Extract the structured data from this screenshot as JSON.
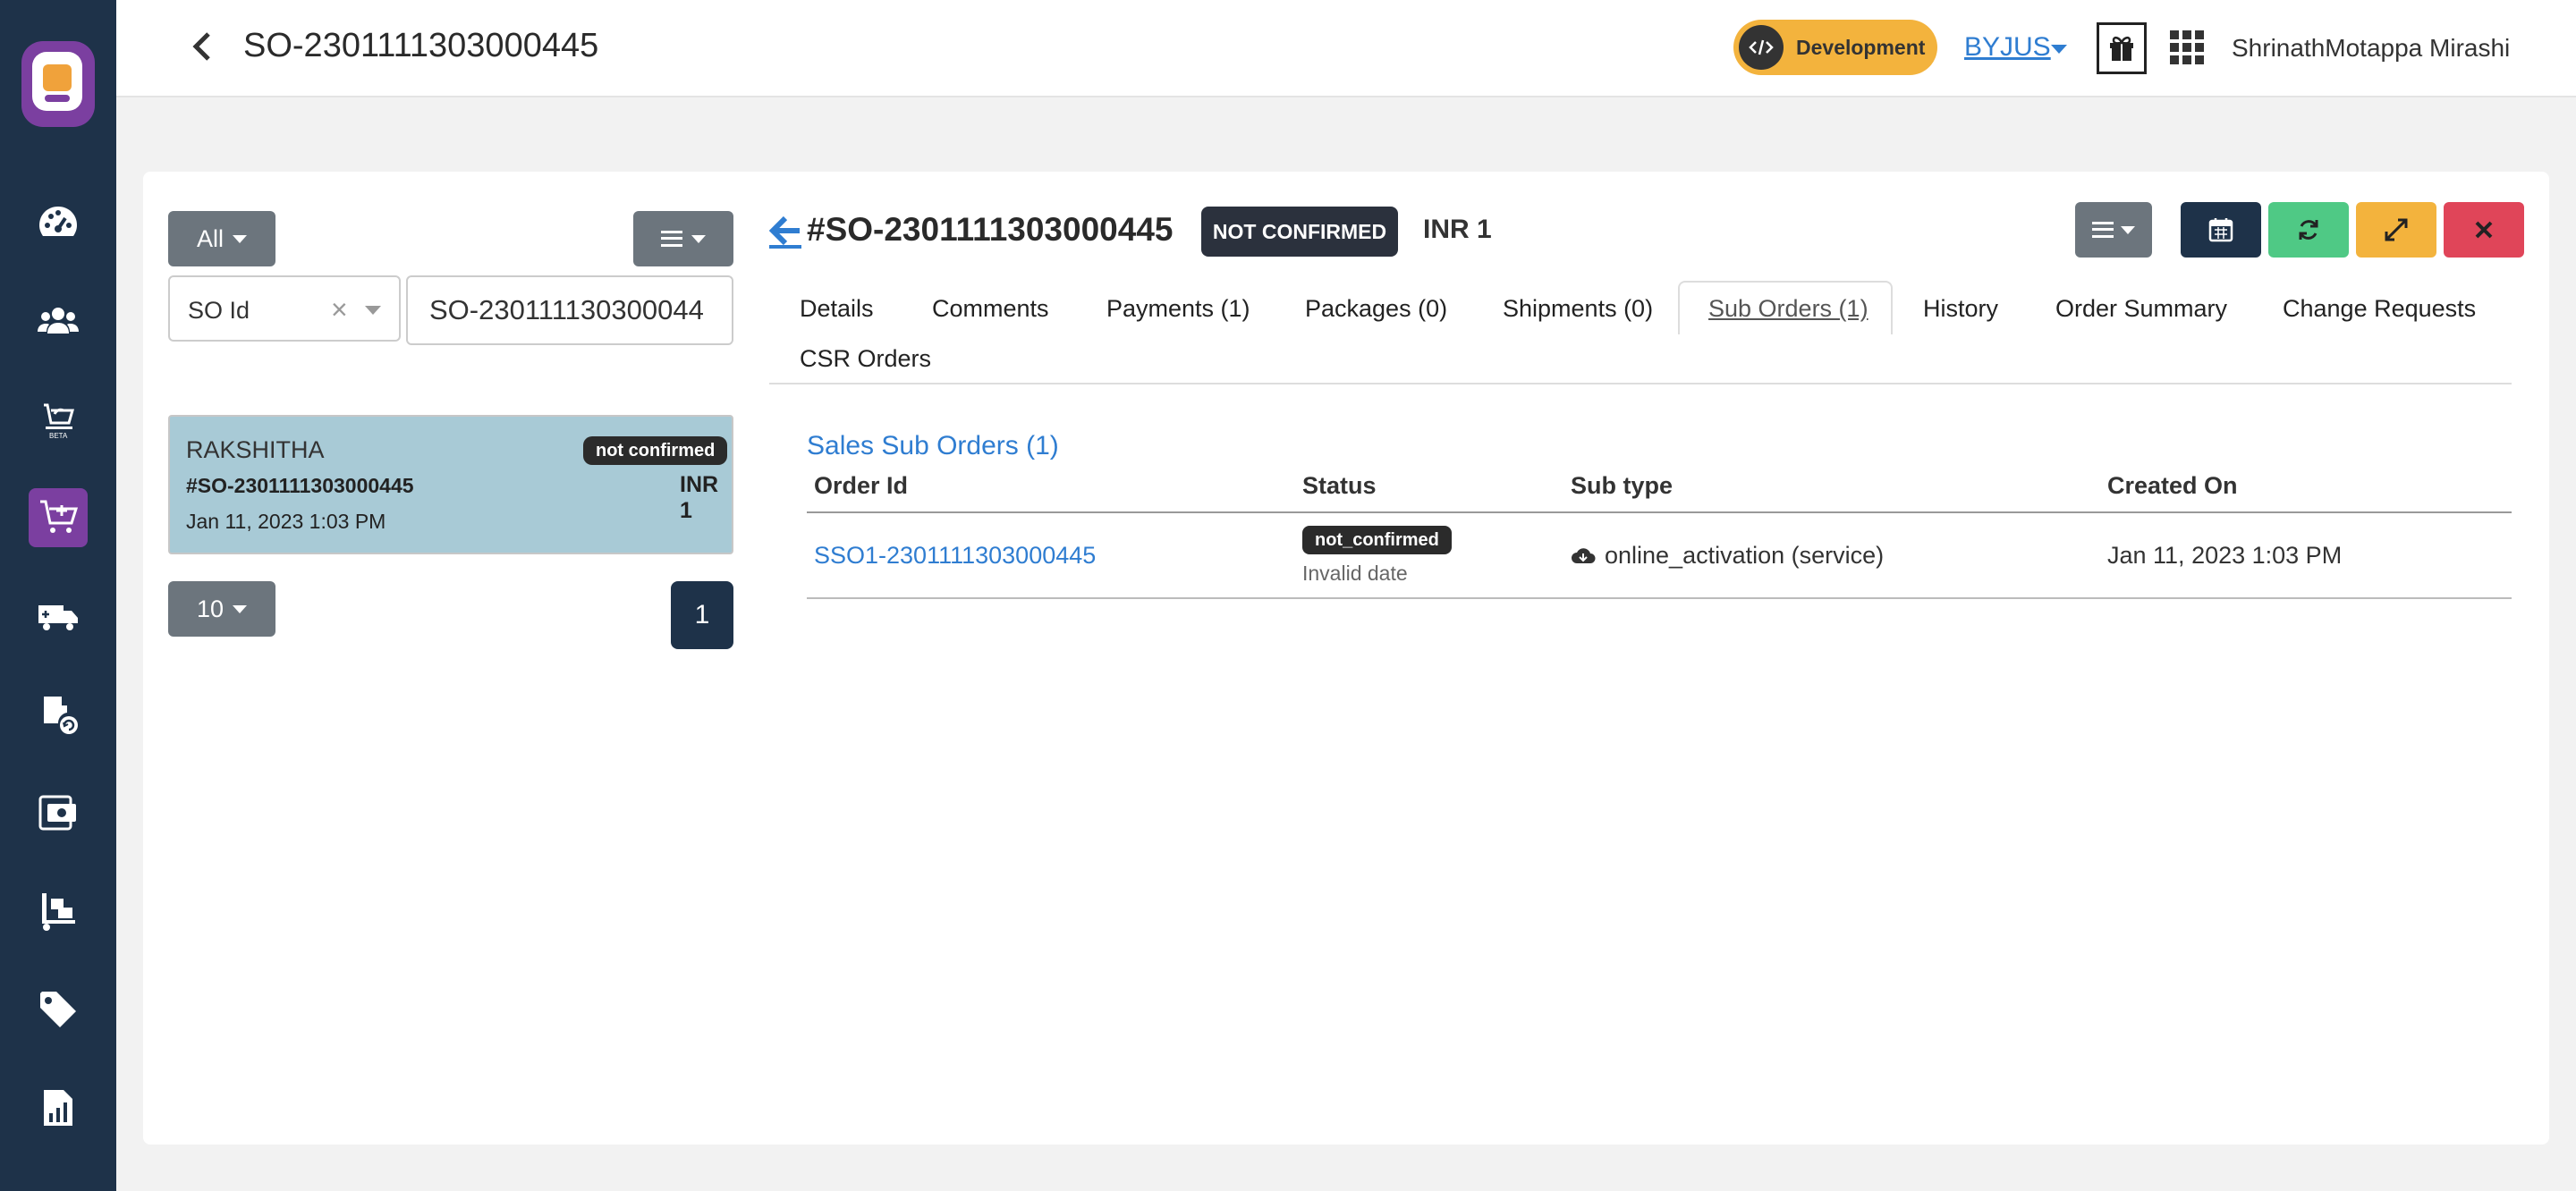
{
  "topbar": {
    "title": "SO-2301111303000445",
    "env_label": "Development",
    "org": "BYJUS",
    "user": "ShrinathMotappa Mirashi"
  },
  "sidebar": {
    "items": [
      {
        "icon": "dashboard-icon"
      },
      {
        "icon": "users-icon"
      },
      {
        "icon": "beta-catalog-icon"
      },
      {
        "icon": "cart-add-icon",
        "active": true
      },
      {
        "icon": "truck-icon"
      },
      {
        "icon": "returns-icon"
      },
      {
        "icon": "payments-icon"
      },
      {
        "icon": "warehouse-icon"
      },
      {
        "icon": "tag-icon"
      },
      {
        "icon": "reports-icon"
      }
    ]
  },
  "left_panel": {
    "filter_label": "All",
    "select_field": "SO Id",
    "search_value": "SO-230111130300044",
    "order": {
      "customer": "RAKSHITHA",
      "status": "not confirmed",
      "id": "#SO-2301111303000445",
      "amount": "INR 1",
      "date": "Jan 11, 2023 1:03 PM"
    },
    "page_size": "10",
    "current_page": "1"
  },
  "detail": {
    "order_id": "#SO-2301111303000445",
    "status": "NOT CONFIRMED",
    "total": "INR 1",
    "colors": {
      "dark": "#1e3249",
      "green": "#4fc985",
      "yellow": "#f3b33d",
      "red": "#e04559",
      "gray": "#6c757d"
    },
    "tabs": [
      "Details",
      "Comments",
      "Payments (1)",
      "Packages (0)",
      "Shipments (0)",
      "Sub Orders (1)",
      "History",
      "Order Summary",
      "Change Requests",
      "CSR Orders"
    ],
    "active_tab": "Sub Orders (1)",
    "sub_orders": {
      "heading": "Sales Sub Orders (1)",
      "columns": [
        "Order Id",
        "Status",
        "Sub type",
        "Created On"
      ],
      "rows": [
        {
          "order_id": "SSO1-2301111303000445",
          "status": "not_confirmed",
          "status_note": "Invalid date",
          "sub_type": "online_activation (service)",
          "created_on": "Jan 11, 2023 1:03 PM"
        }
      ]
    }
  }
}
